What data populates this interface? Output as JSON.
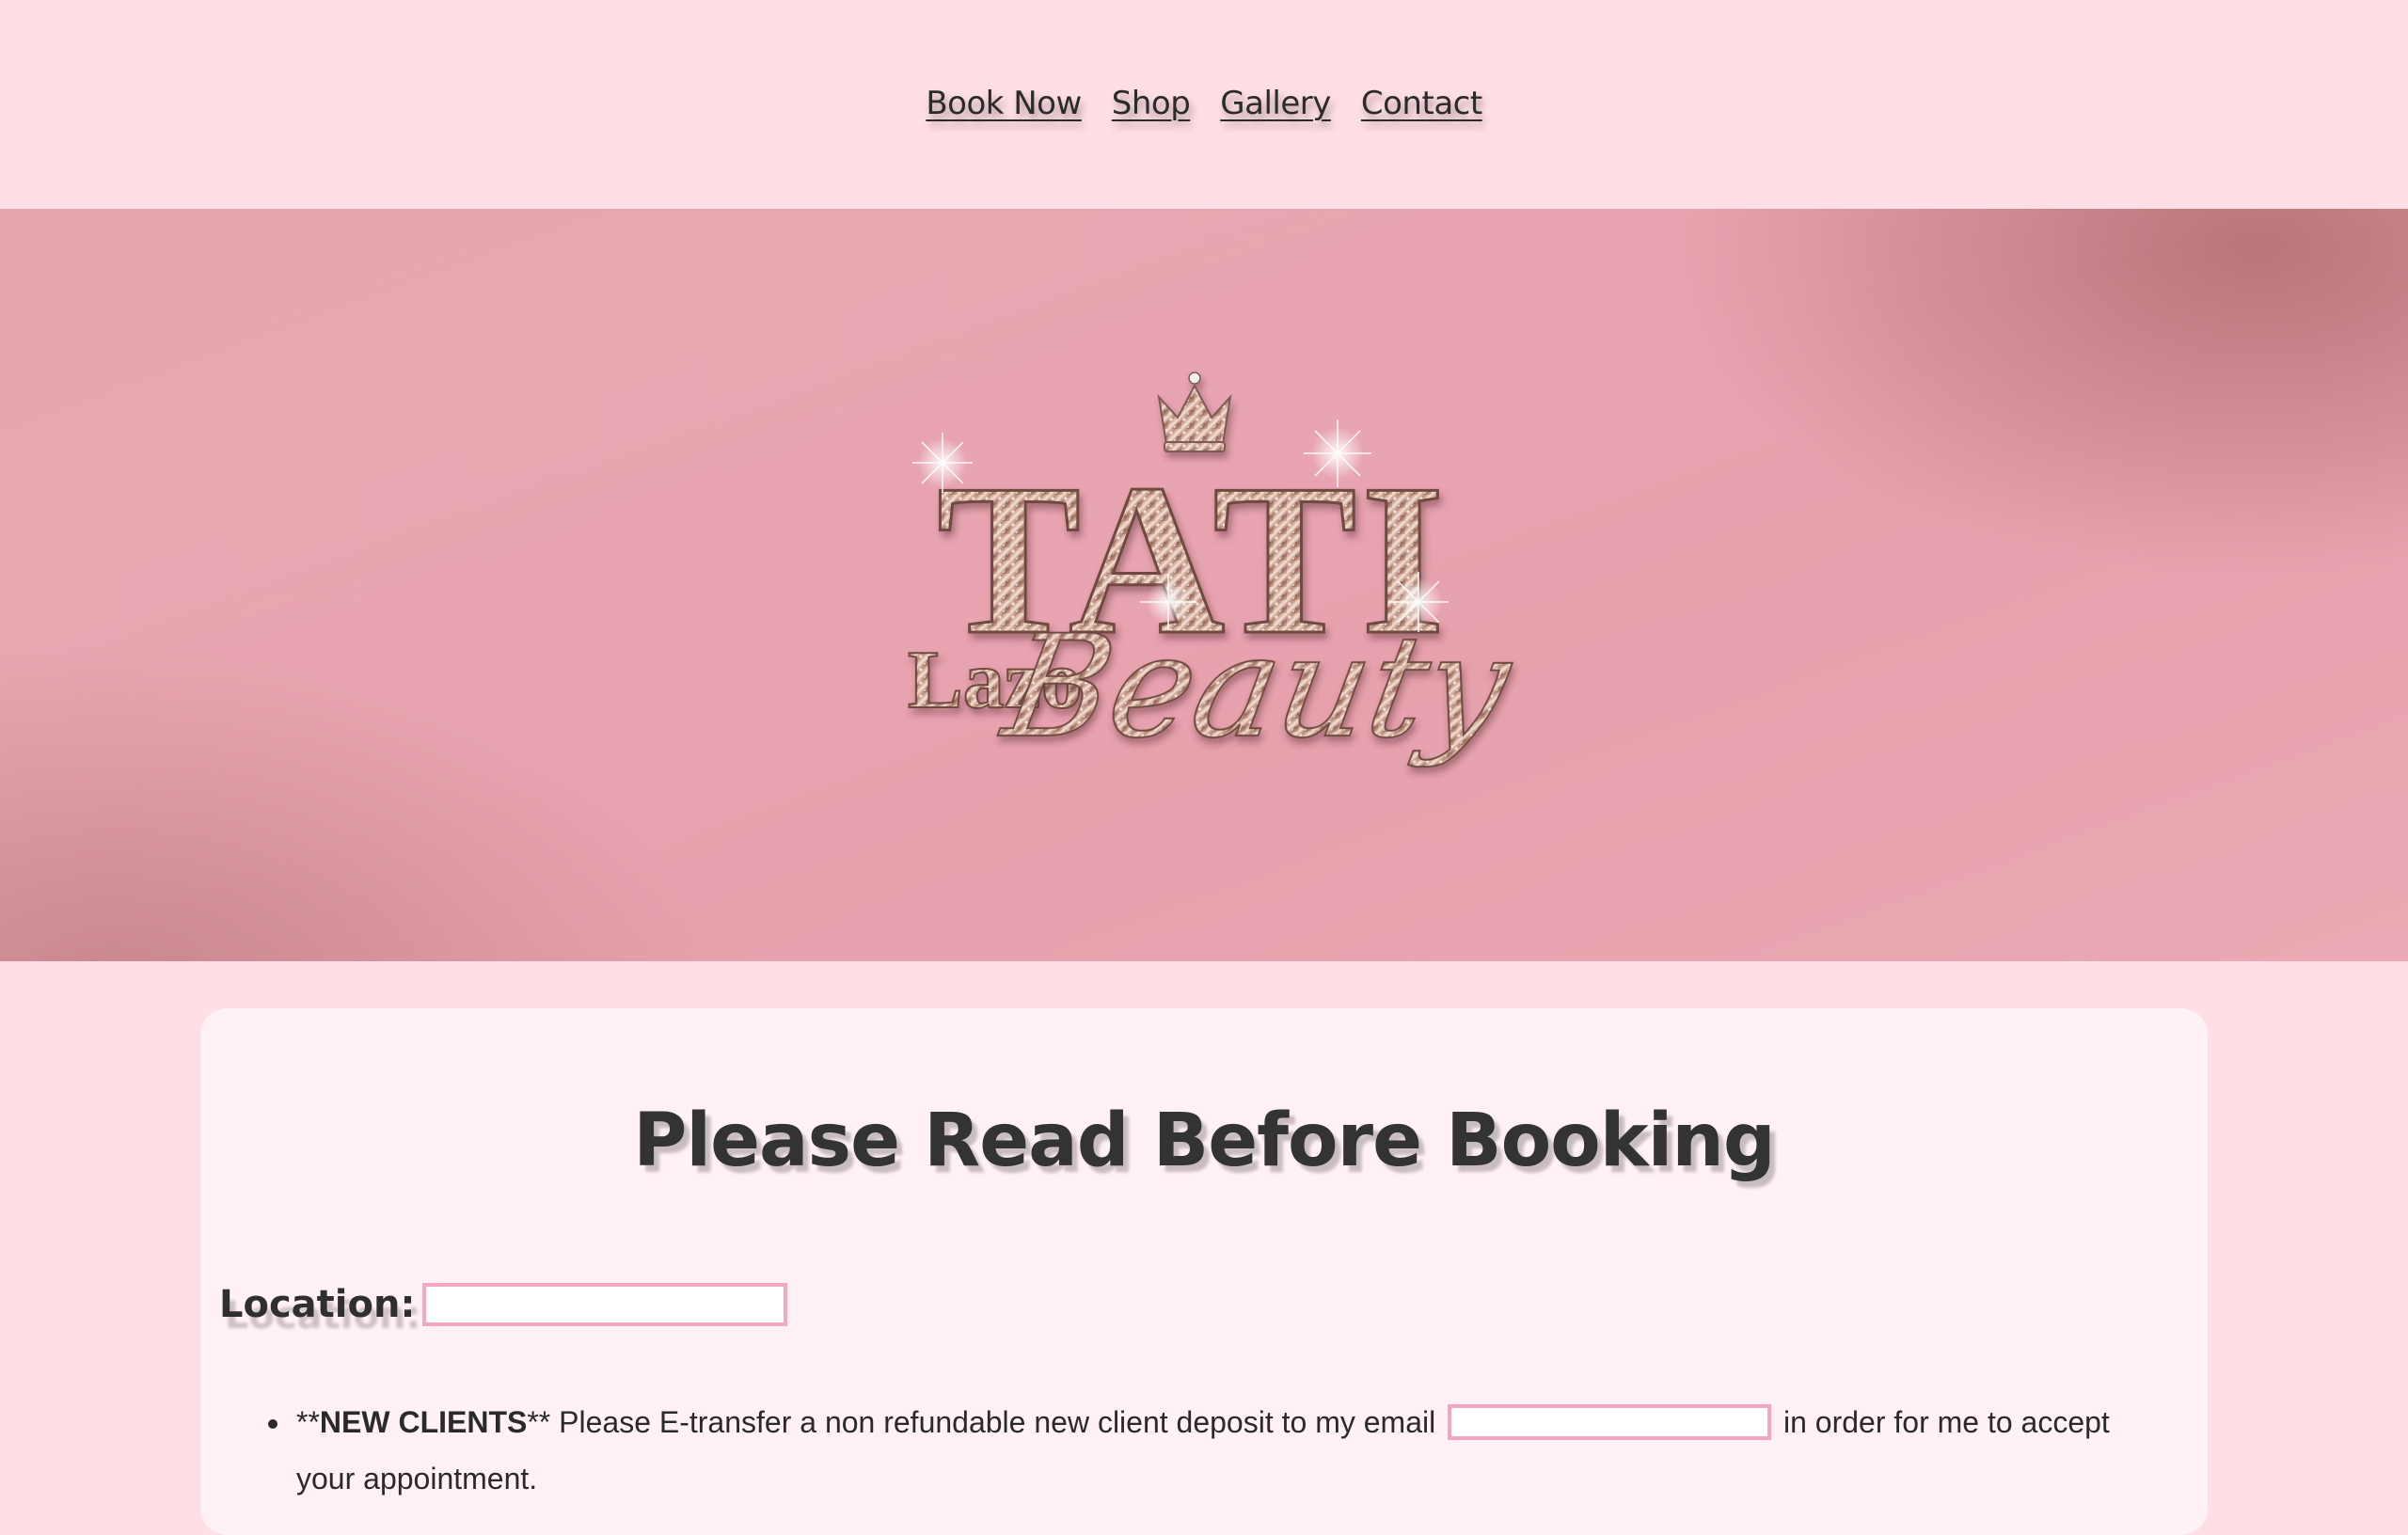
{
  "nav": {
    "items": [
      "Book Now",
      "Shop",
      "Gallery",
      "Contact"
    ]
  },
  "hero": {
    "logo": {
      "title": "TATI",
      "subtitle_left": "Lazo",
      "subtitle_right": "Beauty"
    }
  },
  "content": {
    "headline": "Please Read Before Booking",
    "location_label": "Location:",
    "notes": [
      {
        "prefix": "**",
        "bold": "NEW CLIENTS",
        "middle": "** Please E-transfer a non refundable new client deposit to my email",
        "suffix": "in order for me to accept your appointment."
      }
    ]
  },
  "colors": {
    "page_bg": "#ffdfe5",
    "hero_pink": "#e8a5b1",
    "card_bg": "#fff1f5",
    "redaction_border": "#f4a7bd"
  }
}
